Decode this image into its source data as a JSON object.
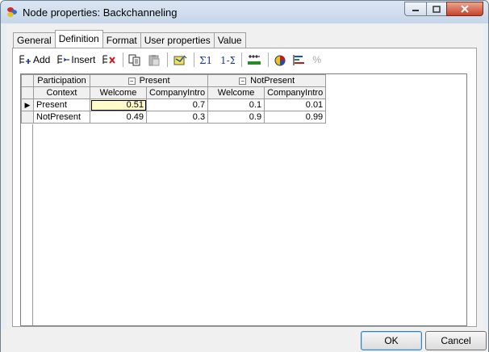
{
  "window": {
    "title": "Node properties: Backchanneling"
  },
  "tabs": [
    {
      "label": "General"
    },
    {
      "label": "Definition"
    },
    {
      "label": "Format"
    },
    {
      "label": "User properties"
    },
    {
      "label": "Value"
    }
  ],
  "active_tab": "Definition",
  "toolbar": {
    "add_label": "Add",
    "insert_label": "Insert",
    "percent_label": "%"
  },
  "table": {
    "corner_top": "Participation",
    "corner_bottom": "Context",
    "groups": [
      {
        "label": "Present",
        "collapse": "−"
      },
      {
        "label": "NotPresent",
        "collapse": "−"
      }
    ],
    "subcols": [
      "Welcome",
      "CompanyIntro",
      "Welcome",
      "CompanyIntro"
    ],
    "rows": [
      {
        "label": "Present",
        "values": [
          "0.51",
          "0.7",
          "0.1",
          "0.01"
        ]
      },
      {
        "label": "NotPresent",
        "values": [
          "0.49",
          "0.3",
          "0.9",
          "0.99"
        ]
      }
    ],
    "current_row_marker": "▶"
  },
  "buttons": {
    "ok": "OK",
    "cancel": "Cancel"
  }
}
